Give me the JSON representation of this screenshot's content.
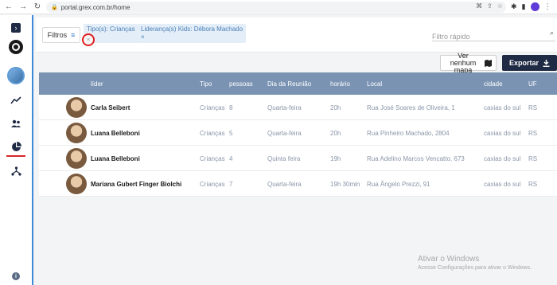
{
  "browser": {
    "url": "portal.grex.com.br/home"
  },
  "filters": {
    "button_label": "Filtros",
    "chips": [
      {
        "label": "Tipo(s): Crianças"
      },
      {
        "label": "Liderança(s) Kids: Débora Machado"
      }
    ],
    "remove_symbol": "×",
    "search_placeholder": "Filtro rápido"
  },
  "actions": {
    "map_label": "Ver nenhum mapa",
    "export_label": "Exportar"
  },
  "table": {
    "columns": [
      "líder",
      "Tipo",
      "pessoas",
      "Dia da Reunião",
      "horário",
      "Local",
      "cidade",
      "UF"
    ],
    "rows": [
      {
        "leader": "Carla Seibert",
        "type": "Crianças",
        "people": "8",
        "day": "Quarta-feira",
        "time": "20h",
        "location": "Rua José Soares de Oliveira, 1",
        "city": "caxias do sul",
        "uf": "RS"
      },
      {
        "leader": "Luana Belleboni",
        "type": "Crianças",
        "people": "5",
        "day": "Quarta-feira",
        "time": "20h",
        "location": "Rua Pinheiro Machado, 2804",
        "city": "caxias do sul",
        "uf": "RS"
      },
      {
        "leader": "Luana Belleboni",
        "type": "Crianças",
        "people": "4",
        "day": "Quinta feira",
        "time": "19h",
        "location": "Rua Adelino Marcos Vencatto, 673",
        "city": "caxias do sul",
        "uf": "RS"
      },
      {
        "leader": "Mariana Gubert Finger Biolchi",
        "type": "Crianças",
        "people": "7",
        "day": "Quarta-feira",
        "time": "19h 30min",
        "location": "Rua Ângelo Prezzi, 91",
        "city": "caxias do sul",
        "uf": "RS"
      }
    ]
  },
  "watermark": {
    "title": "Ativar o Windows",
    "subtitle": "Acesse Configurações para ativar o Windows."
  },
  "colors": {
    "sidebar_accent": "#3f8ad8",
    "header_bg": "#7a93b3",
    "dark_navy": "#1f2a44",
    "active_red": "#d62828"
  },
  "icons": {
    "sidebar": [
      "chevron-right-icon",
      "logo-icon",
      "avatar",
      "trend-chart-icon",
      "people-icon",
      "pie-chart-icon",
      "network-icon",
      "info-icon"
    ]
  }
}
